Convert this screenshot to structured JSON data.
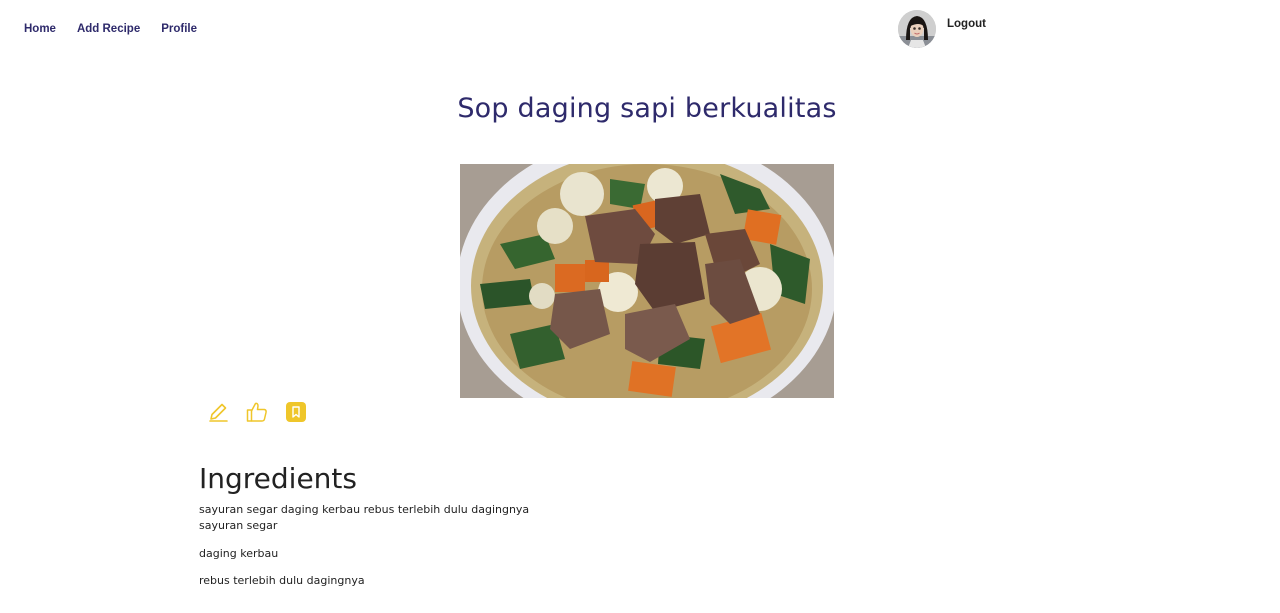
{
  "nav": {
    "links": [
      "Home",
      "Add Recipe",
      "Profile"
    ],
    "logout_label": "Logout"
  },
  "recipe": {
    "title": "Sop daging sapi berkualitas",
    "actions": [
      {
        "icon": "pencil-icon",
        "label": "edit"
      },
      {
        "icon": "thumbs-up-icon",
        "label": "like"
      },
      {
        "icon": "bookmark-icon",
        "label": "save"
      }
    ],
    "ingredients_heading": "Ingredients",
    "ingredients_summary": "sayuran segar daging kerbau rebus terlebih dulu dagingnya",
    "ingredients": [
      "sayuran segar",
      "daging kerbau",
      "rebus terlebih dulu dagingnya"
    ]
  },
  "colors": {
    "brand": "#2e2a6b",
    "accent": "#efc62a"
  }
}
